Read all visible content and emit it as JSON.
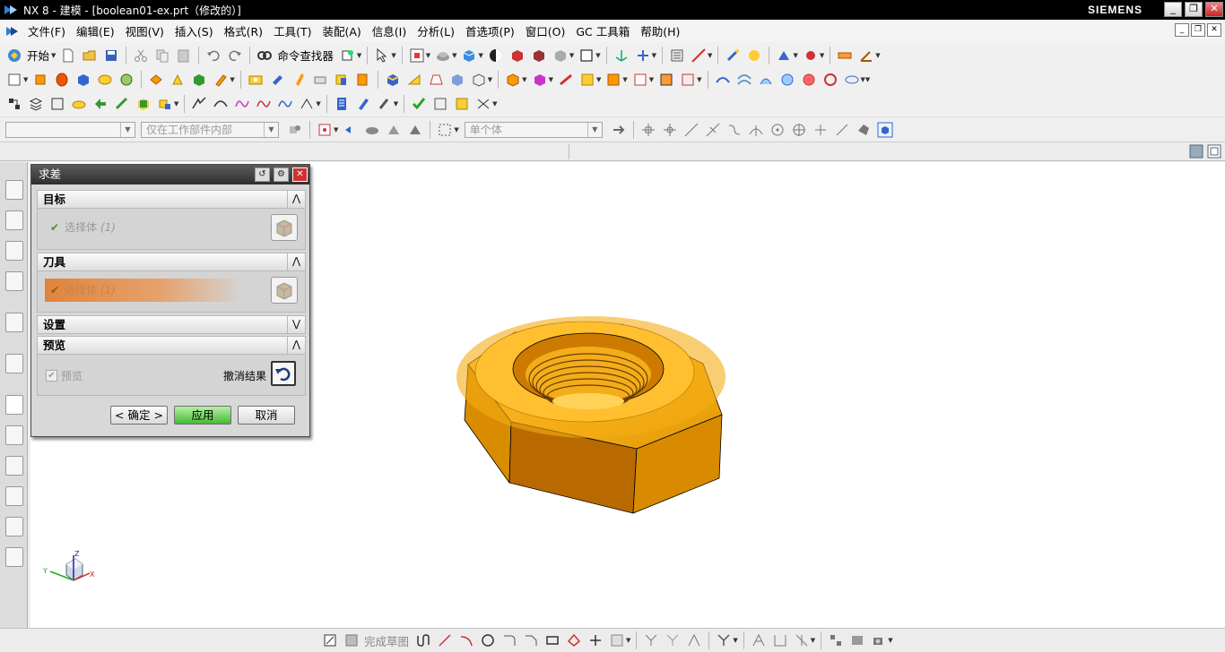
{
  "window": {
    "title": "NX 8 - 建模 - [boolean01-ex.prt（修改的）]",
    "brand": "SIEMENS",
    "controls": [
      "_",
      "❐",
      "✕"
    ]
  },
  "menubar": {
    "items": [
      "文件(F)",
      "编辑(E)",
      "视图(V)",
      "插入(S)",
      "格式(R)",
      "工具(T)",
      "装配(A)",
      "信息(I)",
      "分析(L)",
      "首选项(P)",
      "窗口(O)",
      "GC 工具箱",
      "帮助(H)"
    ]
  },
  "toolbar": {
    "start_label": "开始",
    "command_finder_label": "命令查找器"
  },
  "selection_bar": {
    "filter_value": "",
    "scope_value": "仅在工作部件内部",
    "body_value": "单个体"
  },
  "dialog": {
    "title": "求差",
    "target": {
      "header": "目标",
      "select_label": "选择体",
      "select_count": "(1)"
    },
    "tool": {
      "header": "刀具",
      "select_label": "选择体",
      "select_count": "(1)"
    },
    "settings": {
      "header": "设置"
    },
    "preview": {
      "header": "预览",
      "checkbox_label": "预览",
      "undo_label": "撤消结果"
    },
    "buttons": {
      "ok": "< 确定 >",
      "apply": "应用",
      "cancel": "取消"
    }
  },
  "sketch_bar": {
    "finish_label": "完成草图"
  },
  "triad": {
    "x": "X",
    "y": "Y",
    "z": "Z"
  },
  "colors": {
    "nut_light": "#f7b320",
    "nut_dark": "#b86a00",
    "apply_green": "#47b835",
    "close_red": "#d23030"
  }
}
